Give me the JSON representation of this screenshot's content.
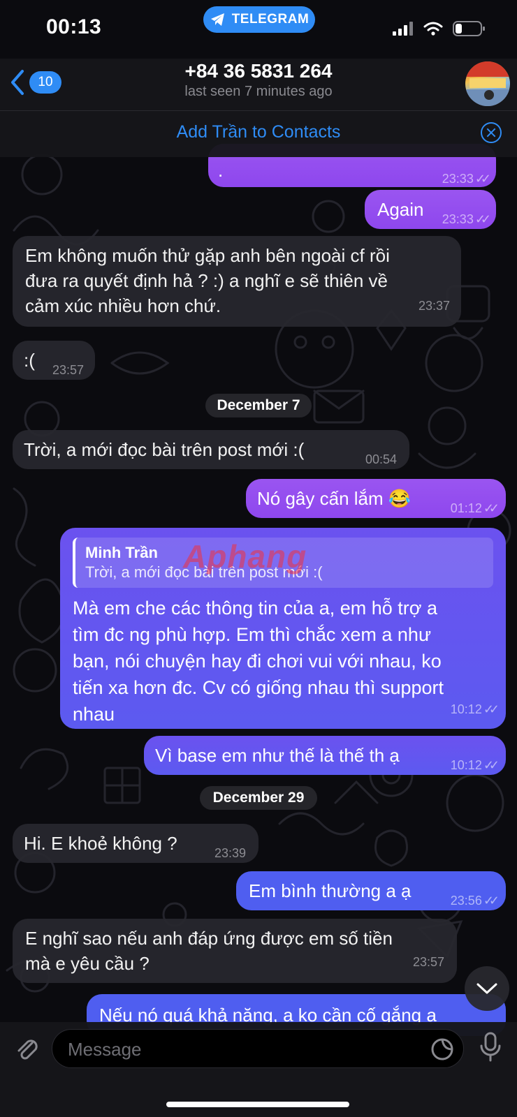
{
  "status_bar": {
    "time": "00:13",
    "app_pill": "TELEGRAM"
  },
  "header": {
    "back_count": "10",
    "contact_name": "+84 36 5831 264",
    "last_seen": "last seen 7 minutes ago"
  },
  "add_contact": {
    "label": "Add Trần to Contacts"
  },
  "messages": [
    {
      "text": ".",
      "time": "23:33",
      "dir": "out"
    },
    {
      "text": "Again",
      "time": "23:33",
      "dir": "out"
    },
    {
      "text_lines": [
        "Em không muốn thử gặp anh bên ngoài cf rồi",
        "đưa ra quyết định hả ? :) a nghĩ e sẽ thiên về",
        "cảm xúc nhiều hơn chứ."
      ],
      "time": "23:37",
      "dir": "in"
    },
    {
      "text": ":(",
      "time": "23:57",
      "dir": "in"
    },
    {
      "text": "Trời, a mới đọc bài trên post mới :(",
      "time": "00:54",
      "dir": "in"
    },
    {
      "text": "Nó gây cấn lắm 😂",
      "time": "01:12",
      "dir": "out"
    },
    {
      "reply_name": "Minh Trần",
      "reply_text": "Trời, a mới đọc bài trên post mới :(",
      "text_lines": [
        "Mà em che các thông tin của a, em hỗ trợ a",
        "tìm đc ng phù hợp. Em thì chắc xem a như",
        "bạn, nói chuyện hay đi chơi vui với nhau, ko",
        "tiến xa hơn đc. Cv có giống nhau thì support",
        "nhau"
      ],
      "time": "10:12",
      "dir": "out"
    },
    {
      "text": "Vì base em như thế là thế th ạ",
      "time": "10:12",
      "dir": "out"
    },
    {
      "text": "Hi. E khoẻ không ?",
      "time": "23:39",
      "dir": "in"
    },
    {
      "text": "Em bình thường a ạ",
      "time": "23:56",
      "dir": "out"
    },
    {
      "text_lines": [
        "E nghĩ sao nếu anh đáp ứng được em số tiền",
        "mà e yêu cầu ?"
      ],
      "time": "23:57",
      "dir": "in"
    },
    {
      "text": "Nếu nó quá khả năng, a ko cần cố gắng ạ",
      "dir": "out"
    }
  ],
  "dates": {
    "d1": "December 7",
    "d2": "December 29"
  },
  "composer": {
    "placeholder": "Message"
  },
  "watermark": "Aphang",
  "colors": {
    "accent": "#2f8cf5",
    "outgoing": "#8e47ee",
    "incoming": "#28282e"
  }
}
